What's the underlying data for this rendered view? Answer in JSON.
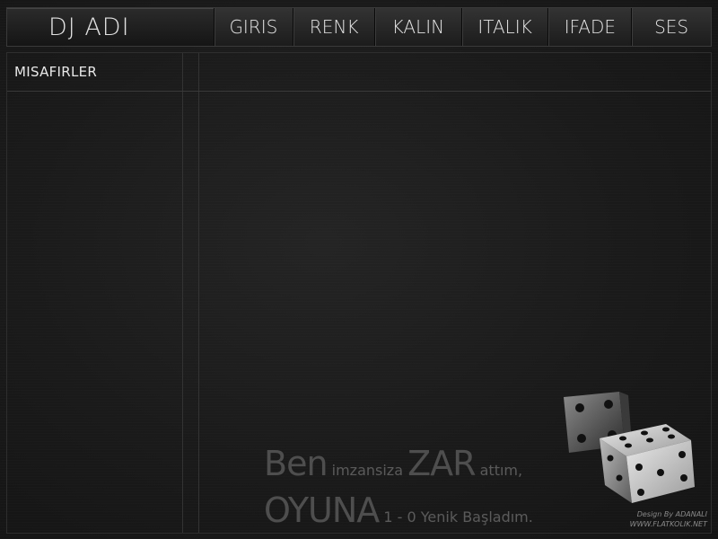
{
  "header": {
    "brand": "DJ ADI",
    "menu": [
      "GIRIS",
      "RENK",
      "KALIN",
      "ITALIK",
      "IFADE",
      "SES"
    ]
  },
  "guests": {
    "title": "MISAFIRLER"
  },
  "slogan": {
    "line1_word1": "Ben",
    "line1_word2": "imzansiza",
    "line1_word3": "ZAR",
    "line1_word4": "attım,",
    "line2_word1": "OYUNA",
    "line2_word2": "1 - 0 Yenik Başladım."
  },
  "credit": {
    "line1": "Design By ADANALI",
    "line2": "WWW.FLATKOLIK.NET"
  },
  "colors": {
    "background": "#1b1b1b",
    "text": "#dcdcdc",
    "border": "#3a3a3a"
  }
}
